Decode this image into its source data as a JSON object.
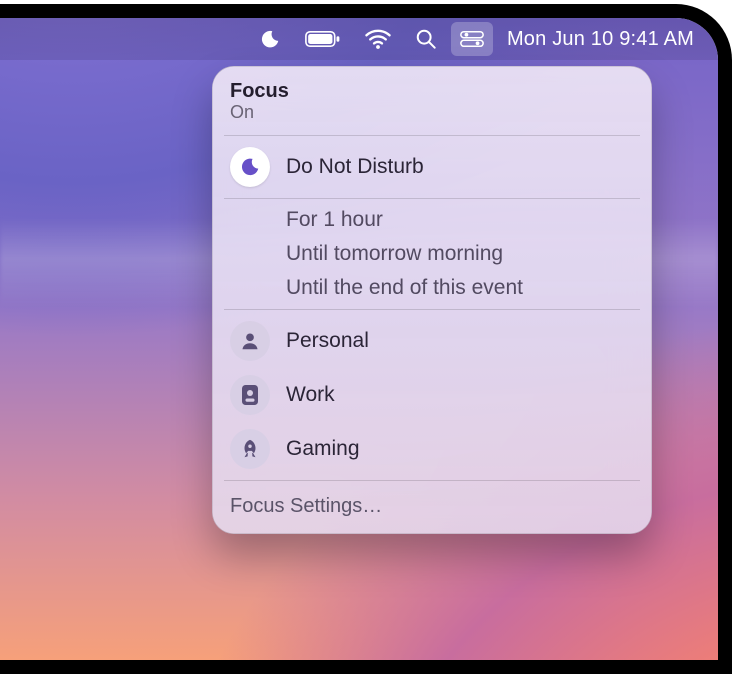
{
  "menubar": {
    "datetime": "Mon Jun 10  9:41 AM"
  },
  "panel": {
    "title": "Focus",
    "status": "On",
    "dnd_label": "Do Not Disturb",
    "duration_options": [
      "For 1 hour",
      "Until tomorrow morning",
      "Until the end of this event"
    ],
    "modes": [
      {
        "label": "Personal",
        "icon": "person"
      },
      {
        "label": "Work",
        "icon": "badge"
      },
      {
        "label": "Gaming",
        "icon": "rocket"
      }
    ],
    "settings_label": "Focus Settings…"
  }
}
